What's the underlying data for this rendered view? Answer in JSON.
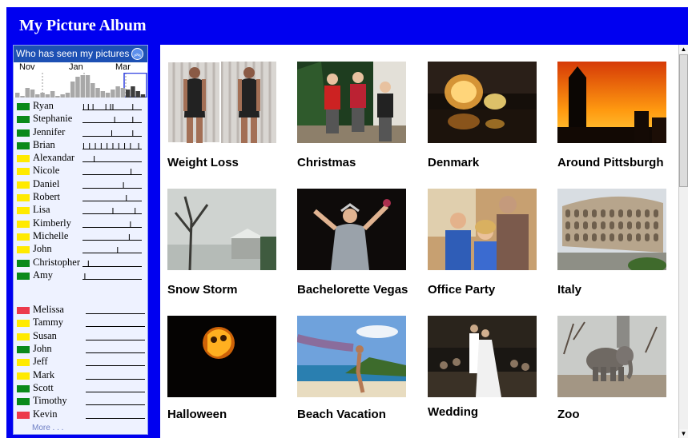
{
  "app": {
    "title": "My Picture Album"
  },
  "sidebar": {
    "header": "Who has seen my pictures",
    "collapse_icon": "double-chevron-up-icon",
    "months": [
      "Nov",
      "Jan",
      "Mar"
    ],
    "viewers": [
      {
        "name": "Ryan",
        "status": "green",
        "views": [
          0.02,
          0.1,
          0.18,
          0.4,
          0.48,
          0.52,
          0.86
        ]
      },
      {
        "name": "Stephanie",
        "status": "green",
        "views": [
          0.55,
          0.86
        ]
      },
      {
        "name": "Jennifer",
        "status": "green",
        "views": [
          0.5,
          0.86
        ]
      },
      {
        "name": "Brian",
        "status": "green",
        "views": [
          0.02,
          0.12,
          0.22,
          0.32,
          0.42,
          0.52,
          0.62,
          0.72,
          0.82,
          0.96
        ]
      },
      {
        "name": "Alexandar",
        "status": "yellow",
        "views": [
          0.2
        ]
      },
      {
        "name": "Nicole",
        "status": "yellow",
        "views": [
          0.83
        ]
      },
      {
        "name": "Daniel",
        "status": "yellow",
        "views": [
          0.7
        ]
      },
      {
        "name": "Robert",
        "status": "yellow",
        "views": [
          0.75
        ]
      },
      {
        "name": "Lisa",
        "status": "yellow",
        "views": [
          0.52,
          0.9
        ]
      },
      {
        "name": "Kimberly",
        "status": "yellow",
        "views": [
          0.82
        ]
      },
      {
        "name": "Michelle",
        "status": "yellow",
        "views": [
          0.8
        ]
      },
      {
        "name": "John",
        "status": "yellow",
        "views": [
          0.6
        ]
      },
      {
        "name": "Christopher",
        "status": "green",
        "views": [
          0.1
        ]
      },
      {
        "name": "Amy",
        "status": "green",
        "views": [
          0.04
        ]
      }
    ],
    "others": [
      {
        "name": "Melissa",
        "status": "red"
      },
      {
        "name": "Tammy",
        "status": "yellow"
      },
      {
        "name": "Susan",
        "status": "yellow"
      },
      {
        "name": "John",
        "status": "green"
      },
      {
        "name": "Jeff",
        "status": "yellow"
      },
      {
        "name": "Mark",
        "status": "yellow"
      },
      {
        "name": "Scott",
        "status": "green"
      },
      {
        "name": "Timothy",
        "status": "green"
      },
      {
        "name": "Kevin",
        "status": "red"
      }
    ],
    "more_label": "More . . .",
    "status_colors": {
      "green": "#0a8a1a",
      "yellow": "#ffea00",
      "red": "#ec3a4c"
    },
    "histogram": [
      3,
      1,
      6,
      5,
      2,
      3,
      2,
      4,
      1,
      2,
      3,
      10,
      13,
      14,
      14,
      9,
      6,
      4,
      3,
      5,
      7,
      6,
      5,
      7,
      4,
      2
    ]
  },
  "albums": [
    {
      "title": "Weight Loss",
      "scene": "people-two"
    },
    {
      "title": "Christmas",
      "scene": "kids"
    },
    {
      "title": "Denmark",
      "scene": "night-lights"
    },
    {
      "title": "Around Pittsburgh",
      "scene": "sunset"
    },
    {
      "title": "Snow Storm",
      "scene": "snow"
    },
    {
      "title": "Bachelorette Vegas",
      "scene": "party-woman"
    },
    {
      "title": "Office Party",
      "scene": "office-party"
    },
    {
      "title": "Italy",
      "scene": "colosseum"
    },
    {
      "title": "Halloween",
      "scene": "pumpkin"
    },
    {
      "title": "Beach Vacation",
      "scene": "beach"
    },
    {
      "title": "Wedding",
      "scene": "wedding"
    },
    {
      "title": "Zoo",
      "scene": "elephant"
    }
  ],
  "scrollbar": {
    "up_icon": "scroll-up-arrow-icon",
    "down_icon": "scroll-down-arrow-icon"
  }
}
